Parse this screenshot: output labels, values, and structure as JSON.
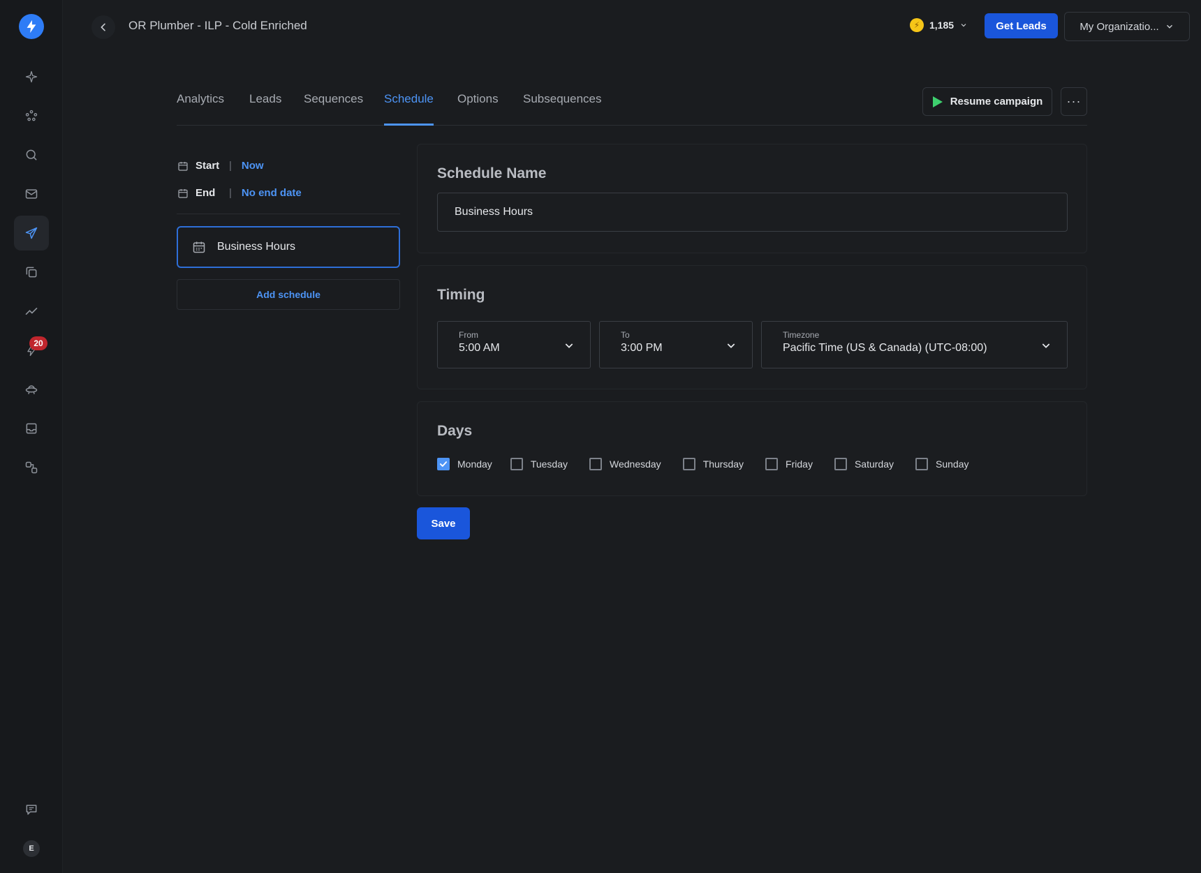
{
  "header": {
    "campaign_title": "OR Plumber - ILP - Cold Enriched",
    "credits": "1,185",
    "get_leads_label": "Get Leads",
    "org_label": "My Organizatio..."
  },
  "sidebar": {
    "items": [
      {
        "icon": "sparkle-icon"
      },
      {
        "icon": "network-icon"
      },
      {
        "icon": "search-icon"
      },
      {
        "icon": "mail-icon"
      },
      {
        "icon": "send-icon",
        "active": true
      },
      {
        "icon": "copy-icon"
      },
      {
        "icon": "chart-line-icon"
      },
      {
        "icon": "bolt-icon",
        "badge": "20"
      },
      {
        "icon": "ufo-icon"
      },
      {
        "icon": "inbox-icon"
      },
      {
        "icon": "integrations-icon"
      }
    ],
    "badge": "20",
    "avatar_initial": "E"
  },
  "tabs": [
    {
      "label": "Analytics"
    },
    {
      "label": "Leads"
    },
    {
      "label": "Sequences"
    },
    {
      "label": "Schedule",
      "active": true
    },
    {
      "label": "Options"
    },
    {
      "label": "Subsequences"
    }
  ],
  "actions": {
    "resume_label": "Resume campaign",
    "more_label": "···"
  },
  "dates": {
    "start_label": "Start",
    "start_value": "Now",
    "end_label": "End",
    "end_value": "No end date"
  },
  "schedules": {
    "items": [
      {
        "name": "Business Hours"
      }
    ],
    "add_label": "Add schedule"
  },
  "schedule_name": {
    "title": "Schedule Name",
    "value": "Business Hours"
  },
  "timing": {
    "title": "Timing",
    "from_label": "From",
    "from_value": "5:00 AM",
    "to_label": "To",
    "to_value": "3:00 PM",
    "timezone_label": "Timezone",
    "timezone_value": "Pacific Time (US & Canada) (UTC-08:00)"
  },
  "days": {
    "title": "Days",
    "items": [
      {
        "label": "Monday",
        "checked": true
      },
      {
        "label": "Tuesday",
        "checked": false
      },
      {
        "label": "Wednesday",
        "checked": false
      },
      {
        "label": "Thursday",
        "checked": false
      },
      {
        "label": "Friday",
        "checked": false
      },
      {
        "label": "Saturday",
        "checked": false
      },
      {
        "label": "Sunday",
        "checked": false
      }
    ]
  },
  "save_label": "Save",
  "colors": {
    "accent": "#4d94f5",
    "primary_button": "#1a56db",
    "play_green": "#3ecf6e",
    "badge_red": "#c0262d"
  }
}
